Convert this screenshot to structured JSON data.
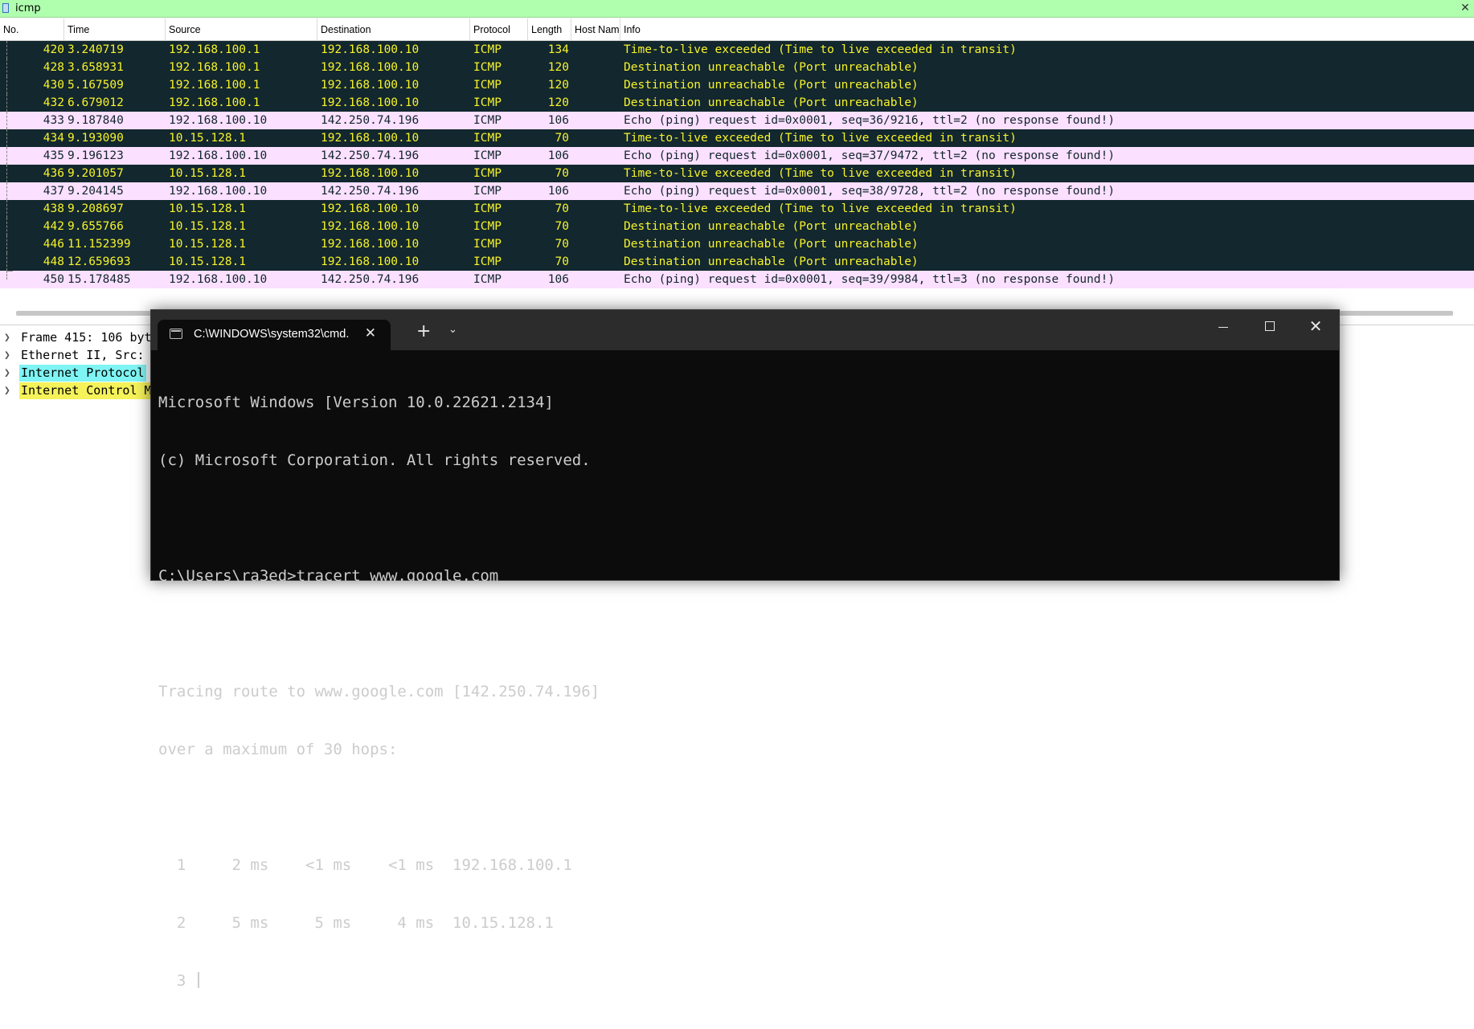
{
  "filter": {
    "value": "icmp",
    "clear_icon": "✕"
  },
  "columns": [
    "No.",
    "Time",
    "Source",
    "Destination",
    "Protocol",
    "Length",
    "Host Nam",
    "Info"
  ],
  "packets": [
    {
      "no": "420",
      "time": "3.240719",
      "src": "192.168.100.1",
      "dst": "192.168.100.10",
      "proto": "ICMP",
      "len": "134",
      "info": "Time-to-live exceeded (Time to live exceeded in transit)",
      "style": "dark"
    },
    {
      "no": "428",
      "time": "3.658931",
      "src": "192.168.100.1",
      "dst": "192.168.100.10",
      "proto": "ICMP",
      "len": "120",
      "info": "Destination unreachable (Port unreachable)",
      "style": "dark"
    },
    {
      "no": "430",
      "time": "5.167509",
      "src": "192.168.100.1",
      "dst": "192.168.100.10",
      "proto": "ICMP",
      "len": "120",
      "info": "Destination unreachable (Port unreachable)",
      "style": "dark"
    },
    {
      "no": "432",
      "time": "6.679012",
      "src": "192.168.100.1",
      "dst": "192.168.100.10",
      "proto": "ICMP",
      "len": "120",
      "info": "Destination unreachable (Port unreachable)",
      "style": "dark"
    },
    {
      "no": "433",
      "time": "9.187840",
      "src": "192.168.100.10",
      "dst": "142.250.74.196",
      "proto": "ICMP",
      "len": "106",
      "info": "Echo (ping) request  id=0x0001, seq=36/9216, ttl=2 (no response found!)",
      "style": "pink"
    },
    {
      "no": "434",
      "time": "9.193090",
      "src": "10.15.128.1",
      "dst": "192.168.100.10",
      "proto": "ICMP",
      "len": "70",
      "info": "Time-to-live exceeded (Time to live exceeded in transit)",
      "style": "dark"
    },
    {
      "no": "435",
      "time": "9.196123",
      "src": "192.168.100.10",
      "dst": "142.250.74.196",
      "proto": "ICMP",
      "len": "106",
      "info": "Echo (ping) request  id=0x0001, seq=37/9472, ttl=2 (no response found!)",
      "style": "pink"
    },
    {
      "no": "436",
      "time": "9.201057",
      "src": "10.15.128.1",
      "dst": "192.168.100.10",
      "proto": "ICMP",
      "len": "70",
      "info": "Time-to-live exceeded (Time to live exceeded in transit)",
      "style": "dark"
    },
    {
      "no": "437",
      "time": "9.204145",
      "src": "192.168.100.10",
      "dst": "142.250.74.196",
      "proto": "ICMP",
      "len": "106",
      "info": "Echo (ping) request  id=0x0001, seq=38/9728, ttl=2 (no response found!)",
      "style": "pink"
    },
    {
      "no": "438",
      "time": "9.208697",
      "src": "10.15.128.1",
      "dst": "192.168.100.10",
      "proto": "ICMP",
      "len": "70",
      "info": "Time-to-live exceeded (Time to live exceeded in transit)",
      "style": "dark"
    },
    {
      "no": "442",
      "time": "9.655766",
      "src": "10.15.128.1",
      "dst": "192.168.100.10",
      "proto": "ICMP",
      "len": "70",
      "info": "Destination unreachable (Port unreachable)",
      "style": "dark"
    },
    {
      "no": "446",
      "time": "11.152399",
      "src": "10.15.128.1",
      "dst": "192.168.100.10",
      "proto": "ICMP",
      "len": "70",
      "info": "Destination unreachable (Port unreachable)",
      "style": "dark"
    },
    {
      "no": "448",
      "time": "12.659693",
      "src": "10.15.128.1",
      "dst": "192.168.100.10",
      "proto": "ICMP",
      "len": "70",
      "info": "Destination unreachable (Port unreachable)",
      "style": "dark"
    },
    {
      "no": "450",
      "time": "15.178485",
      "src": "192.168.100.10",
      "dst": "142.250.74.196",
      "proto": "ICMP",
      "len": "106",
      "info": "Echo (ping) request  id=0x0001, seq=39/9984, ttl=3 (no response found!)",
      "style": "pink"
    }
  ],
  "details": [
    {
      "text": "Frame 415: 106 byt",
      "style": "plain"
    },
    {
      "text": "Ethernet II, Src:",
      "style": "plain"
    },
    {
      "text": "Internet Protocol",
      "style": "ip"
    },
    {
      "text": "Internet Control M",
      "style": "icmpd"
    }
  ],
  "terminal": {
    "tab_title": "C:\\WINDOWS\\system32\\cmd.",
    "lines": [
      "Microsoft Windows [Version 10.0.22621.2134]",
      "(c) Microsoft Corporation. All rights reserved.",
      "",
      "C:\\Users\\ra3ed>tracert www.google.com",
      "",
      "Tracing route to www.google.com [142.250.74.196]",
      "over a maximum of 30 hops:",
      "",
      "  1     2 ms    <1 ms    <1 ms  192.168.100.1",
      "  2     5 ms     5 ms     4 ms  10.15.128.1",
      "  3 "
    ]
  },
  "colors": {
    "filter_valid_bg": "#afffaf",
    "row_dark_bg": "#12272e",
    "row_dark_fg": "#f7f32a",
    "row_pink_bg": "#fce0ff",
    "detail_ip_bg": "#7ff4f4",
    "detail_icmp_bg": "#f5f25a"
  }
}
